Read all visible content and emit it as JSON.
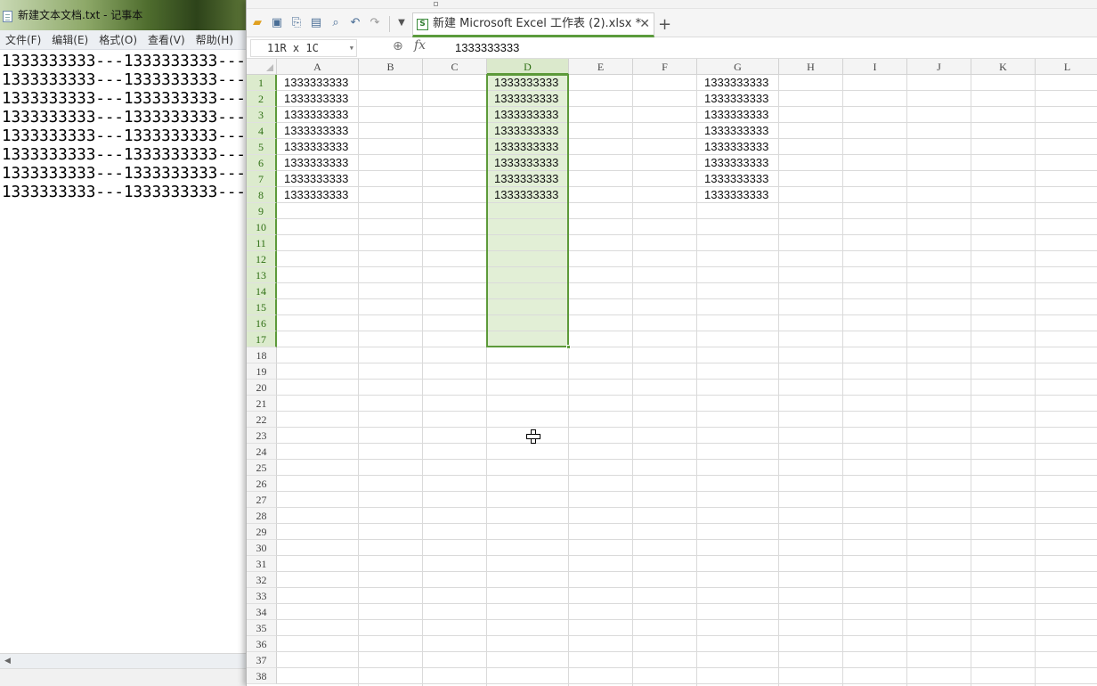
{
  "notepad": {
    "title": "新建文本文档.txt - 记事本",
    "menu": [
      "文件(F)",
      "编辑(E)",
      "格式(O)",
      "查看(V)",
      "帮助(H)"
    ],
    "lines": [
      "1333333333---1333333333---",
      "1333333333---1333333333---",
      "1333333333---1333333333---",
      "1333333333---1333333333---",
      "1333333333---1333333333---",
      "1333333333---1333333333---",
      "1333333333---1333333333---",
      "1333333333---1333333333---"
    ],
    "icon": "notepad-icon"
  },
  "toolbar": {
    "icons": [
      "open-folder-icon",
      "save-icon",
      "export-pdf-icon",
      "print-icon",
      "print-preview-icon",
      "undo-icon",
      "redo-icon",
      "dropdown-icon"
    ]
  },
  "tab": {
    "title": "新建 Microsoft Excel 工作表 (2).xlsx *",
    "close": "✕",
    "new": "+"
  },
  "formula_bar": {
    "name_box": "11R x 1C",
    "fx": "fx",
    "value": "1333333333"
  },
  "sheet": {
    "columns": [
      "A",
      "B",
      "C",
      "D",
      "E",
      "F",
      "G",
      "H",
      "I",
      "J",
      "K",
      "L"
    ],
    "selected_column": "D",
    "rows": [
      "1",
      "2",
      "3",
      "4",
      "5",
      "6",
      "7",
      "8",
      "9",
      "10",
      "11",
      "12",
      "13",
      "14",
      "15",
      "16",
      "17",
      "18",
      "19",
      "20",
      "21",
      "22",
      "23",
      "24",
      "25",
      "26",
      "27",
      "28",
      "29",
      "30",
      "31",
      "32",
      "33",
      "34",
      "35",
      "36",
      "37",
      "38"
    ],
    "selected_rows": [
      "1",
      "2",
      "3",
      "4",
      "5",
      "6",
      "7",
      "8",
      "9",
      "10",
      "11",
      "12",
      "13",
      "14",
      "15",
      "16",
      "17"
    ],
    "column_A": [
      "1333333333",
      "1333333333",
      "1333333333",
      "1333333333",
      "1333333333",
      "1333333333",
      "1333333333",
      "1333333333"
    ],
    "column_D": [
      "1333333333",
      "1333333333",
      "1333333333",
      "1333333333",
      "1333333333",
      "1333333333",
      "1333333333",
      "1333333333"
    ],
    "column_G": [
      "1333333333",
      "1333333333",
      "1333333333",
      "1333333333",
      "1333333333",
      "1333333333",
      "1333333333",
      "1333333333"
    ],
    "selection_color": "#5d9a3a",
    "selection_fill": "#e2efd6"
  }
}
